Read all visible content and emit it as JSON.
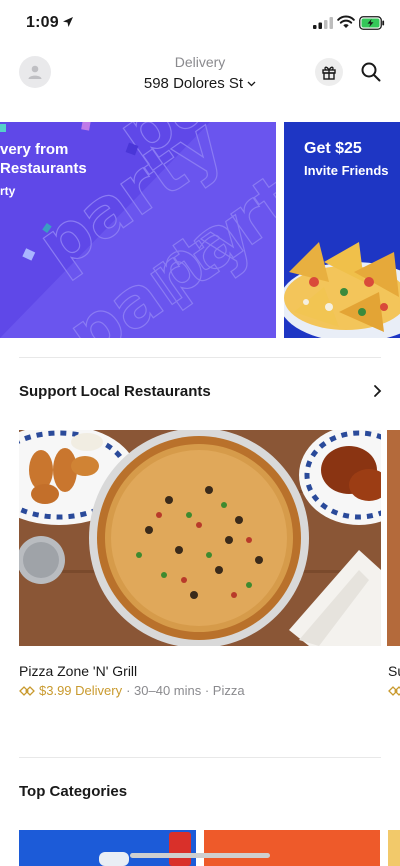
{
  "status_bar": {
    "time": "1:09"
  },
  "header": {
    "delivery_label": "Delivery",
    "address": "598 Dolores St"
  },
  "banners": {
    "purple": {
      "line1": "very from",
      "line2": "Restaurants",
      "line3": "rty",
      "pattern_word": "party",
      "color": "#5f48e8"
    },
    "blue": {
      "title": "Get $25",
      "subtitle": "Invite Friends",
      "color": "#1e36c4"
    }
  },
  "sections": {
    "support_local": {
      "title": "Support Local Restaurants"
    },
    "top_categories": {
      "title": "Top Categories"
    }
  },
  "stores": [
    {
      "name": "Pizza Zone 'N' Grill",
      "delivery_fee": "$3.99 Delivery",
      "details": "· 30–40 mins · Pizza"
    },
    {
      "name": "Su"
    }
  ],
  "colors": {
    "accent_fee": "#c99a2e",
    "muted_text": "#8a8a8e",
    "divider": "#e8e8e8"
  }
}
